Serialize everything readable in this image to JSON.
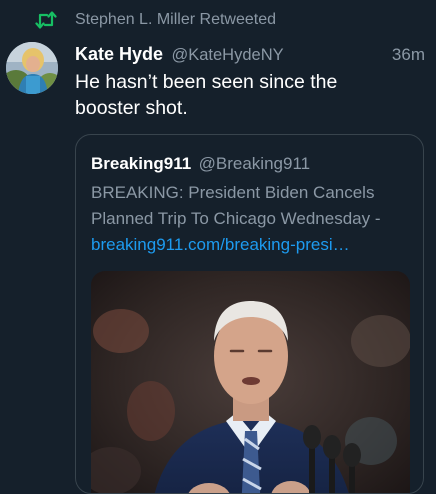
{
  "retweet": {
    "icon": "retweet-icon",
    "text": "Stephen L. Miller Retweeted",
    "color": "#17bf63"
  },
  "tweet": {
    "avatar_icon": "user-avatar",
    "display_name": "Kate Hyde",
    "handle": "@KateHydeNY",
    "timestamp": "36m",
    "text_line1": "He hasn’t been seen since the",
    "text_line2": "booster shot."
  },
  "quoted": {
    "display_name": "Breaking911",
    "handle": "@Breaking911",
    "text_line1": "BREAKING: President Biden Cancels",
    "text_line2": "Planned Trip To Chicago Wednesday -",
    "link": "breaking911.com/breaking-presi…",
    "link_color": "#1d9bf0",
    "image_icon": "news-photo-image"
  },
  "colors": {
    "background": "#15202b",
    "secondary_text": "#8b98a5",
    "border": "#38444d"
  }
}
